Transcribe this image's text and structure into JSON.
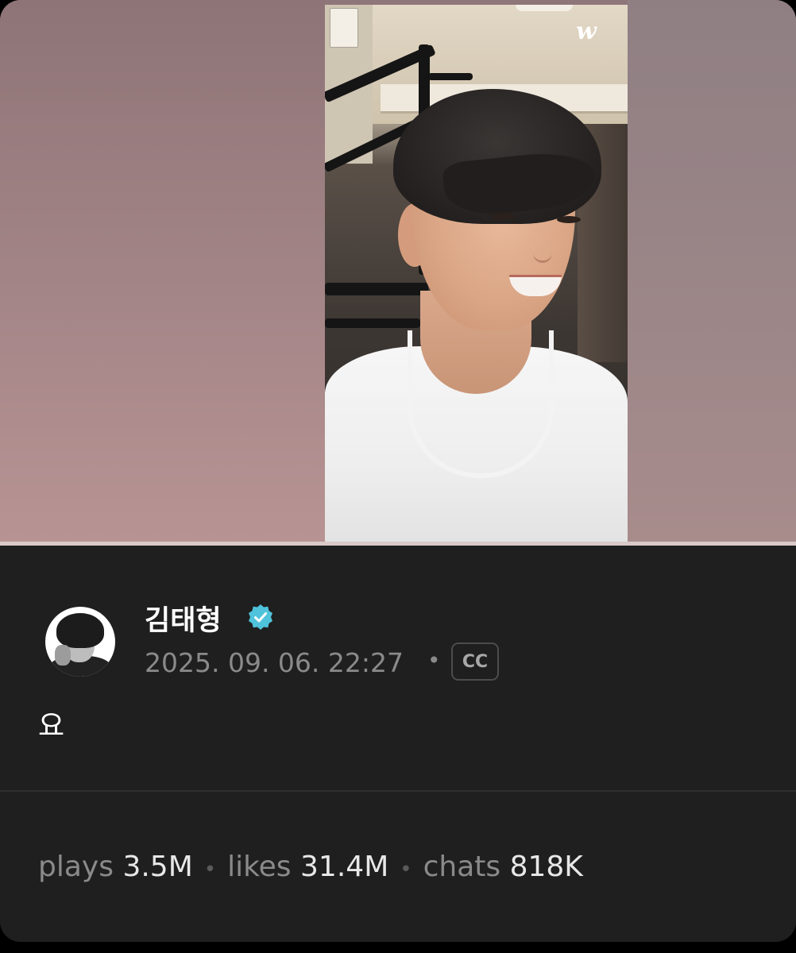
{
  "video": {
    "logo_text": "w"
  },
  "post": {
    "author": "김태형",
    "verified": true,
    "timestamp": "2025. 09. 06. 22:27",
    "separator": "•",
    "cc_label": "CC",
    "body": "요"
  },
  "stats": {
    "plays_label": "plays",
    "plays_value": "3.5M",
    "likes_label": "likes",
    "likes_value": "31.4M",
    "chats_label": "chats",
    "chats_value": "818K",
    "separator": "•"
  },
  "colors": {
    "background": "#1f1f1f",
    "verified_badge": "#4fc3dc",
    "text_primary": "#ffffff",
    "text_secondary": "#8a8a8a"
  }
}
